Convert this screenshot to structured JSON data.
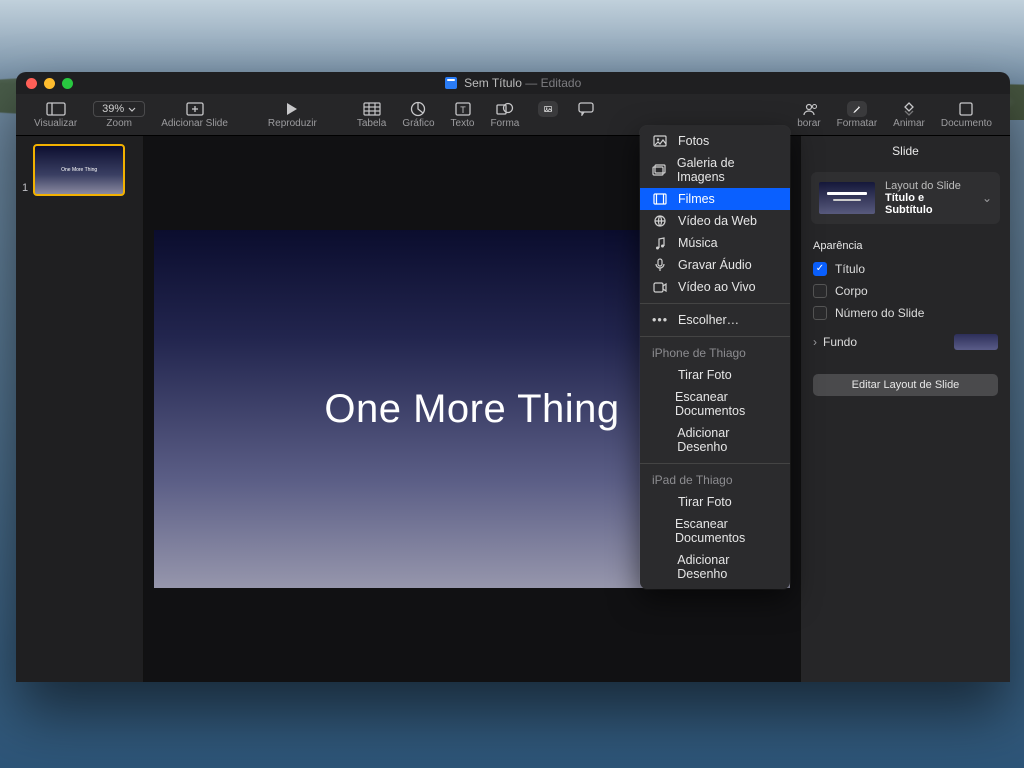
{
  "titlebar": {
    "doc": "Sem Título",
    "status": "Editado"
  },
  "toolbar": {
    "view": "Visualizar",
    "zoom_value": "39%",
    "zoom_label": "Zoom",
    "add_slide": "Adicionar Slide",
    "play": "Reproduzir",
    "table": "Tabela",
    "chart": "Gráfico",
    "text": "Texto",
    "shape": "Forma",
    "media": "Mídia",
    "comment": "Comentar",
    "collaborate": "borar",
    "format": "Formatar",
    "animate": "Animar",
    "document": "Documento"
  },
  "sidebar": {
    "slides": [
      {
        "number": "1",
        "title": "One More Thing"
      }
    ]
  },
  "canvas": {
    "title": "One More Thing"
  },
  "inspector": {
    "tab": "Slide",
    "layout_label": "Layout do Slide",
    "layout_name": "Título e Subtítulo",
    "appearance": "Aparência",
    "checks": {
      "title": "Título",
      "body": "Corpo",
      "slide_number": "Número do Slide"
    },
    "background": "Fundo",
    "edit_layout": "Editar Layout de Slide"
  },
  "dropdown": {
    "items": [
      {
        "label": "Fotos"
      },
      {
        "label": "Galeria de Imagens"
      },
      {
        "label": "Filmes",
        "selected": true
      },
      {
        "label": "Vídeo da Web"
      },
      {
        "label": "Música"
      },
      {
        "label": "Gravar Áudio"
      },
      {
        "label": "Vídeo ao Vivo"
      }
    ],
    "choose": "Escolher…",
    "iphone_header": "iPhone de Thiago",
    "iphone_take_photo": "Tirar Foto",
    "iphone_scan": "Escanear Documentos",
    "iphone_sketch": "Adicionar Desenho",
    "ipad_header": "iPad de Thiago",
    "ipad_take_photo": "Tirar Foto",
    "ipad_scan": "Escanear Documentos",
    "ipad_sketch": "Adicionar Desenho"
  }
}
